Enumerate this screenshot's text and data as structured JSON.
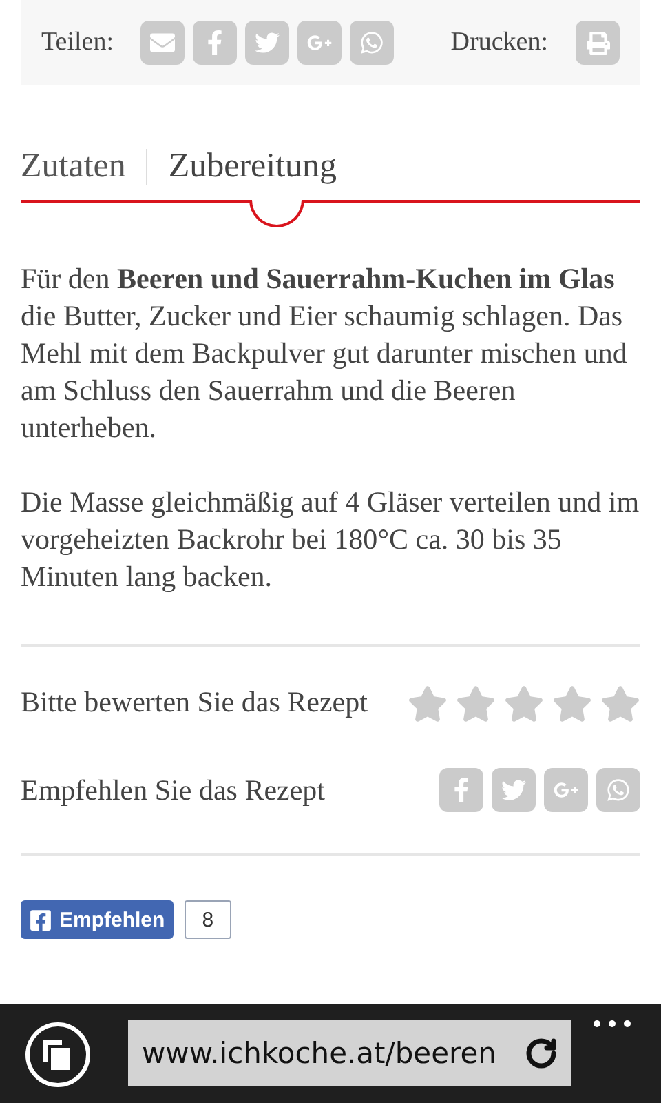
{
  "share_bar": {
    "share_label": "Teilen:",
    "share_icons": [
      {
        "kind": "mail"
      },
      {
        "kind": "facebook"
      },
      {
        "kind": "twitter"
      },
      {
        "kind": "googleplus"
      },
      {
        "kind": "whatsapp"
      }
    ],
    "print_label": "Drucken:"
  },
  "tabs": [
    {
      "label": "Zutaten",
      "selected": false
    },
    {
      "label": "Zubereitung",
      "selected": true
    }
  ],
  "paragraphs": [
    "Für den **Beeren und Sauerrahm-Kuchen im Glas** die Butter, Zucker und Eier schaumig schlagen. Das Mehl mit dem Backpulver gut darunter mischen und am Schluss den Sauerrahm und die Beeren unterheben.",
    "Die Masse gleichmäßig auf 4 Gläser verteilen und im vorgeheizten Backrohr bei 180°C ca. 30 bis 35 Minuten lang backen."
  ],
  "rating": {
    "label": "Bitte bewerten Sie das Rezept",
    "stars": 0
  },
  "recommend": {
    "label": "Empfehlen Sie das Rezept",
    "icons": [
      {
        "kind": "facebook"
      },
      {
        "kind": "twitter"
      },
      {
        "kind": "googleplus"
      },
      {
        "kind": "whatsapp"
      }
    ]
  },
  "facebook_like": {
    "label": "Empfehlen",
    "count": "8"
  },
  "browser_bar": {
    "url": "www.ichkoche.at/beeren"
  }
}
